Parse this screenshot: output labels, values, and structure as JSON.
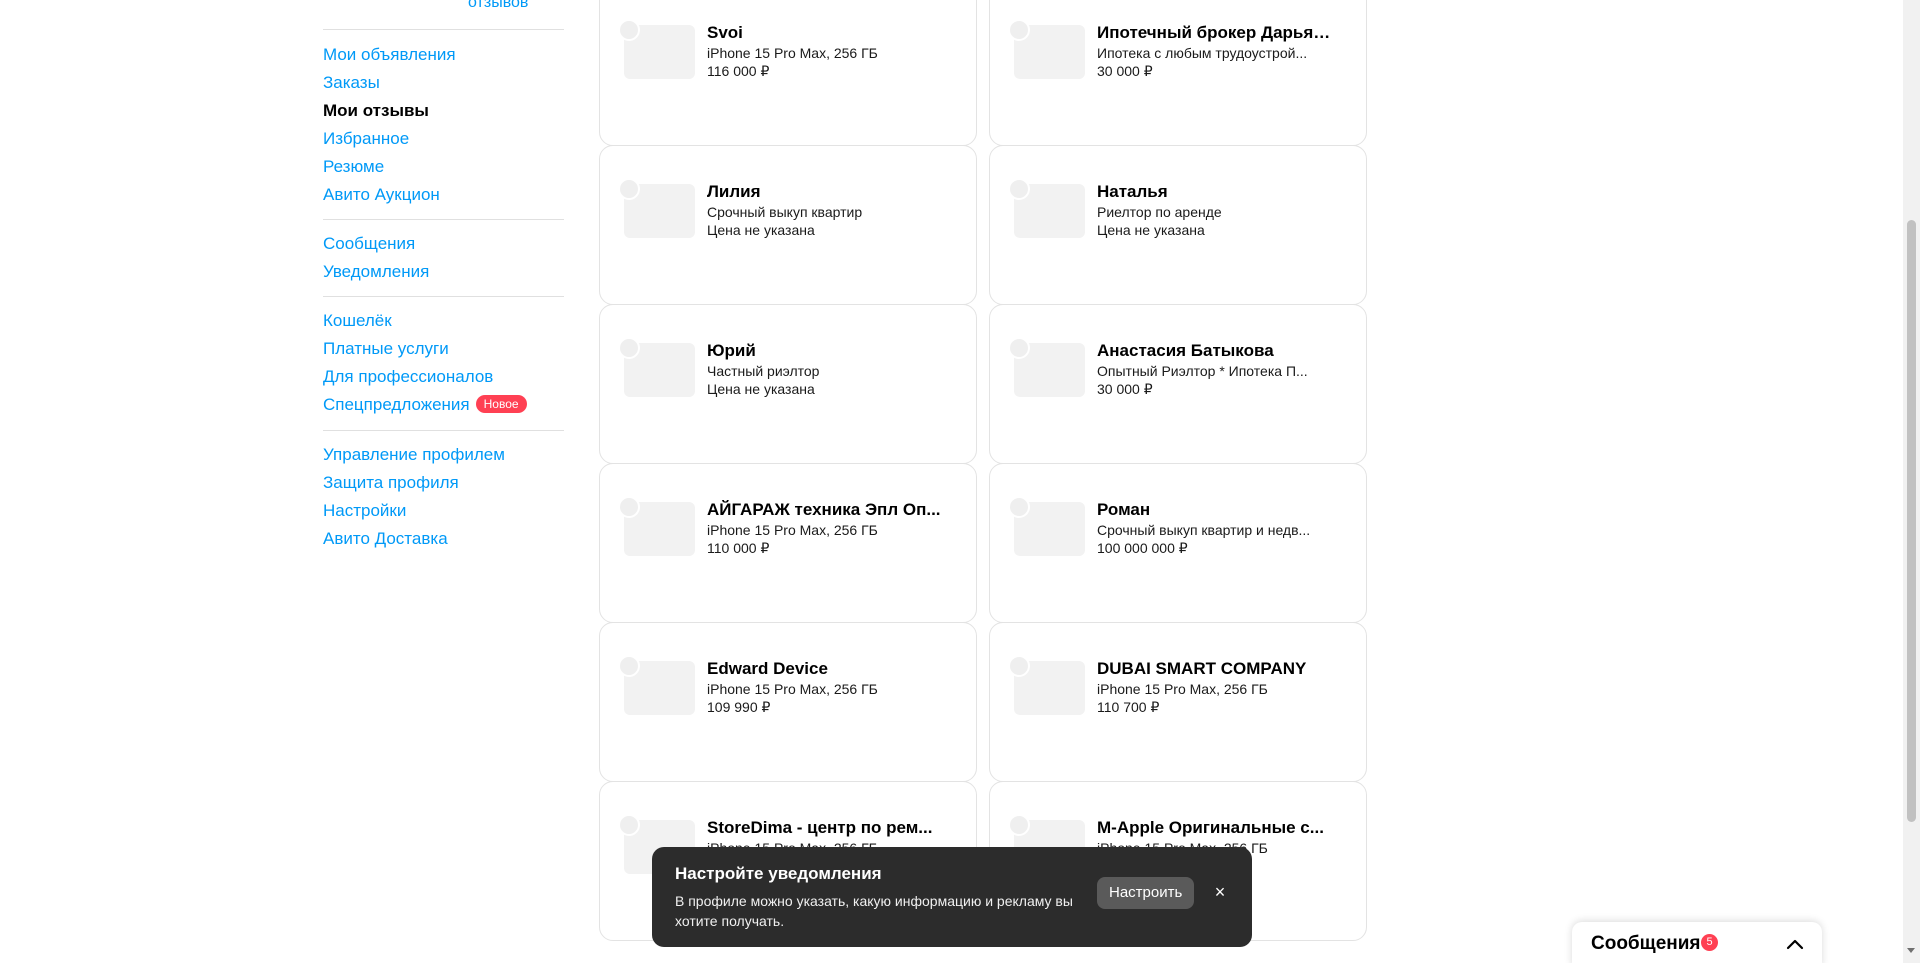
{
  "sidebar": {
    "reviews_link": "отзывов",
    "groups": [
      [
        {
          "label": "Мои объявления",
          "active": false
        },
        {
          "label": "Заказы",
          "active": false
        },
        {
          "label": "Мои отзывы",
          "active": true
        },
        {
          "label": "Избранное",
          "active": false
        },
        {
          "label": "Резюме",
          "active": false
        },
        {
          "label": "Авито Аукцион",
          "active": false
        }
      ],
      [
        {
          "label": "Сообщения",
          "active": false
        },
        {
          "label": "Уведомления",
          "active": false
        }
      ],
      [
        {
          "label": "Кошелёк",
          "active": false
        },
        {
          "label": "Платные услуги",
          "active": false
        },
        {
          "label": "Для профессионалов",
          "active": false
        },
        {
          "label": "Спецпредложения",
          "active": false,
          "badge": "Новое"
        }
      ],
      [
        {
          "label": "Управление профилем",
          "active": false
        },
        {
          "label": "Защита профиля",
          "active": false
        },
        {
          "label": "Настройки",
          "active": false
        },
        {
          "label": "Авито Доставка",
          "active": false
        }
      ]
    ]
  },
  "cards": [
    {
      "name": "Svoi",
      "sub": "iPhone 15 Pro Max, 256 ГБ",
      "price": "116 000 ₽"
    },
    {
      "name": "Ипотечный брокер Дарья ...",
      "sub": "Ипотека с любым трудоустрой...",
      "price": "30 000 ₽"
    },
    {
      "name": "Лилия",
      "sub": "Срочный выкуп квартир",
      "price": "Цена не указана"
    },
    {
      "name": "Наталья",
      "sub": "Риелтор по аренде",
      "price": "Цена не указана"
    },
    {
      "name": "Юрий",
      "sub": "Частный риэлтор",
      "price": "Цена не указана"
    },
    {
      "name": "Анастасия Батыкова",
      "sub": "Опытный Риэлтор * Ипотека П...",
      "price": "30 000 ₽"
    },
    {
      "name": "АЙГАРАЖ техника Эпл Оп...",
      "sub": "iPhone 15 Pro Max, 256 ГБ",
      "price": "110 000 ₽"
    },
    {
      "name": "Роман",
      "sub": "Срочный выкуп квартир и недв...",
      "price": "100 000 000 ₽"
    },
    {
      "name": "Edward Device",
      "sub": "iPhone 15 Pro Max, 256 ГБ",
      "price": "109 990 ₽"
    },
    {
      "name": "DUBAI SMART COMPANY",
      "sub": "iPhone 15 Pro Max, 256 ГБ",
      "price": "110 700 ₽"
    },
    {
      "name": "StoreDima - центр по рем...",
      "sub": "iPhone 15 Pro Max, 256 ГБ",
      "price": ""
    },
    {
      "name": "M-Apple Оригинальные с...",
      "sub": "iPhone 15 Pro Max, 256 ГБ",
      "price": ""
    }
  ],
  "toast": {
    "title": "Настройте уведомления",
    "body": "В профиле можно указать, какую информацию и рекламу вы хотите получать.",
    "button": "Настроить",
    "close": "×"
  },
  "messenger": {
    "label": "Сообщения",
    "count": "5"
  },
  "colors": {
    "link": "#0099f7",
    "badge": "#ff4053",
    "toast_bg": "#2c2c2c"
  }
}
